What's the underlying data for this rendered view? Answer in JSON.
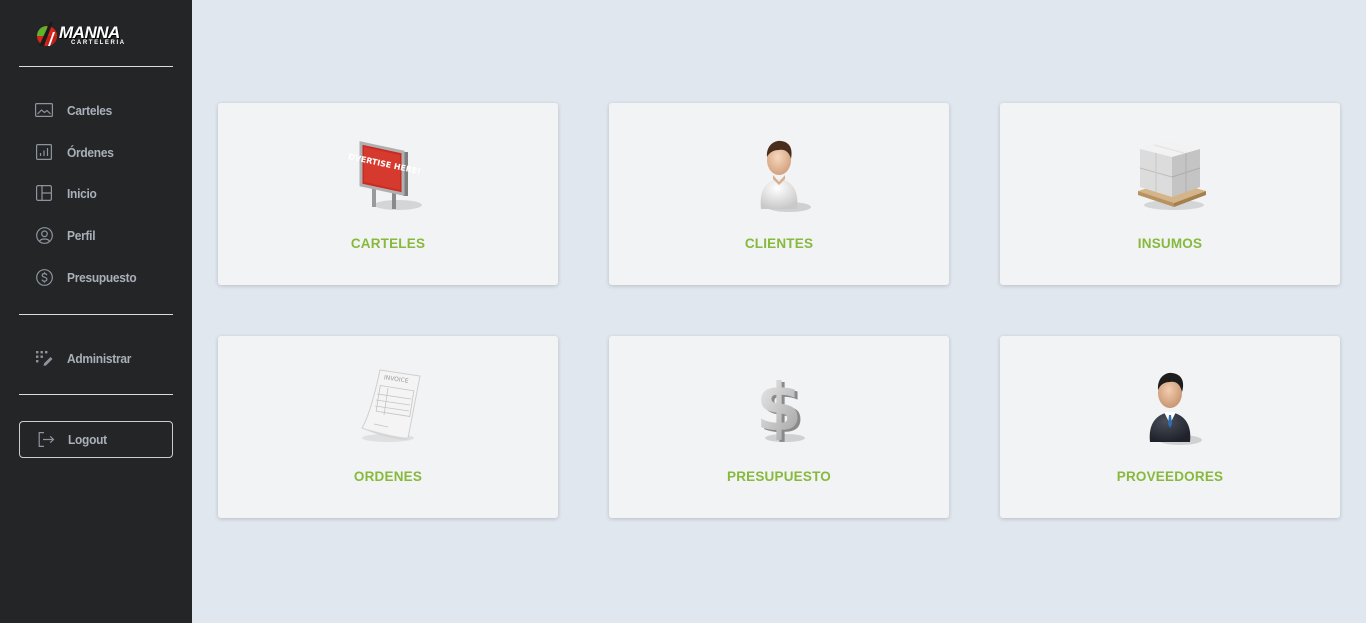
{
  "logo": {
    "title": "MANNA",
    "subtitle": "CARTELERIA"
  },
  "sidebar": {
    "items": [
      {
        "label": "Carteles",
        "icon": "image-icon"
      },
      {
        "label": "Órdenes",
        "icon": "bar-chart-icon"
      },
      {
        "label": "Inicio",
        "icon": "layout-icon"
      },
      {
        "label": "Perfil",
        "icon": "user-circle-icon"
      },
      {
        "label": "Presupuesto",
        "icon": "dollar-circle-icon"
      }
    ],
    "admin": {
      "label": "Administrar",
      "icon": "grid-edit-icon"
    },
    "logout": {
      "label": "Logout",
      "icon": "logout-icon"
    }
  },
  "cards": [
    {
      "label": "CARTELES",
      "icon": "billboard-icon",
      "image_text": "ADVERTISE HERE!"
    },
    {
      "label": "CLIENTES",
      "icon": "person-icon"
    },
    {
      "label": "INSUMOS",
      "icon": "boxes-pallet-icon"
    },
    {
      "label": "ORDENES",
      "icon": "invoice-icon",
      "image_text": "INVOICE"
    },
    {
      "label": "PRESUPUESTO",
      "icon": "dollar-sign-icon"
    },
    {
      "label": "PROVEEDORES",
      "icon": "businessman-icon"
    }
  ],
  "colors": {
    "sidebar_bg": "#242527",
    "page_bg": "#e1e7ef",
    "card_bg": "#f2f3f5",
    "accent": "#86b93c",
    "nav_text": "#a9b0b9"
  }
}
